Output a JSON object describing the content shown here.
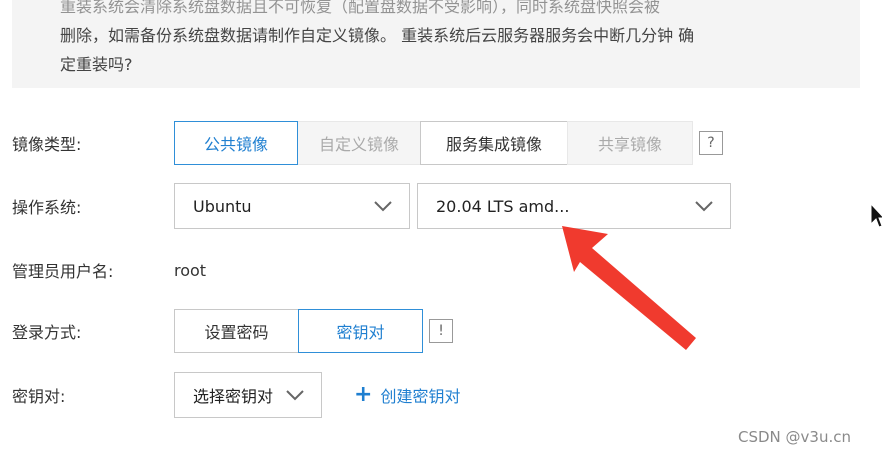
{
  "warning": {
    "line0": "重装系统会清除系统盘数据且不可恢复（配置盘数据不受影响），同时系统盘快照会被",
    "line1": "删除，如需备份系统盘数据请制作自定义镜像。 重装系统后云服务器服务会中断几分钟 确",
    "line2": "定重装吗?"
  },
  "image_type": {
    "label": "镜像类型:",
    "options": [
      {
        "label": "公共镜像",
        "state": "active"
      },
      {
        "label": "自定义镜像",
        "state": "disabled"
      },
      {
        "label": "服务集成镜像",
        "state": "normal"
      },
      {
        "label": "共享镜像",
        "state": "disabled"
      }
    ],
    "help": "?"
  },
  "os": {
    "label": "操作系统:",
    "os_value": "Ubuntu",
    "version_value": "20.04 LTS amd..."
  },
  "admin": {
    "label": "管理员用户名:",
    "value": "root"
  },
  "login": {
    "label": "登录方式:",
    "options": [
      {
        "label": "设置密码",
        "state": "normal"
      },
      {
        "label": "密钥对",
        "state": "active"
      }
    ],
    "info": "!"
  },
  "keypair": {
    "label": "密钥对:",
    "select_value": "选择密钥对",
    "create_label": "创建密钥对",
    "create_icon": "plus-icon"
  },
  "colors": {
    "accent": "#1f7fd0",
    "annotation_arrow": "#f03a2e"
  },
  "watermark": "CSDN @v3u.cn"
}
